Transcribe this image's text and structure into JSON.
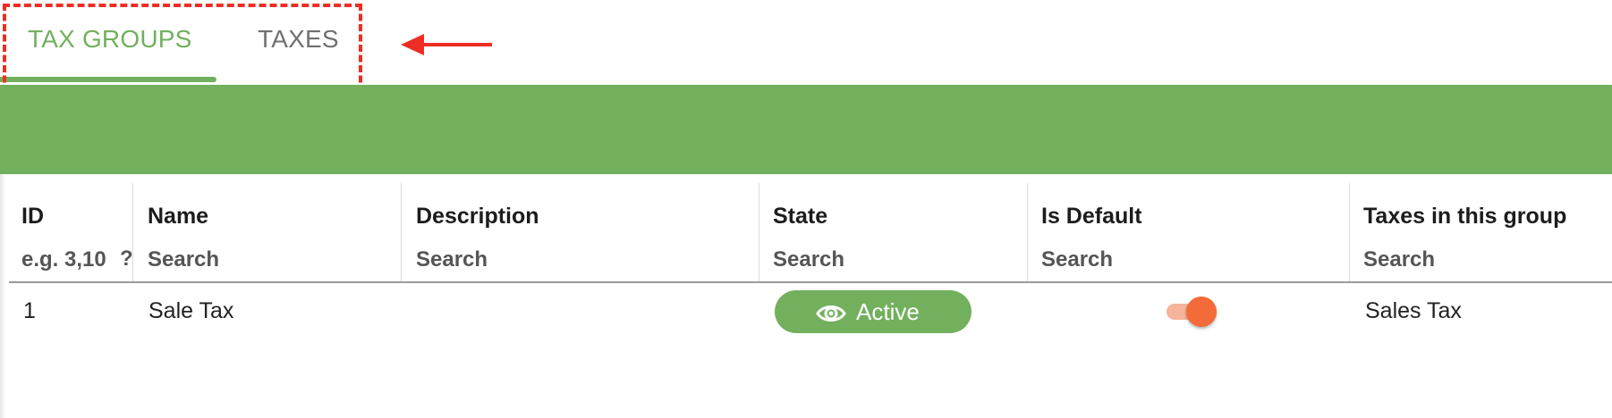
{
  "tabs": [
    {
      "label": "TAX GROUPS",
      "active": true
    },
    {
      "label": "TAXES",
      "active": false
    }
  ],
  "colors": {
    "accent_green": "#72b05d",
    "annotation_red": "#ee2e24",
    "toggle_orange": "#f26b38"
  },
  "table": {
    "columns": [
      {
        "title": "ID",
        "filter_placeholder": "e.g. 3,10",
        "filter_help": "?"
      },
      {
        "title": "Name",
        "filter_placeholder": "Search"
      },
      {
        "title": "Description",
        "filter_placeholder": "Search"
      },
      {
        "title": "State",
        "filter_placeholder": "Search"
      },
      {
        "title": "Is Default",
        "filter_placeholder": "Search"
      },
      {
        "title": "Taxes in this group",
        "filter_placeholder": "Search"
      }
    ],
    "rows": [
      {
        "id": "1",
        "name": "Sale Tax",
        "description": "",
        "state": "Active",
        "state_icon": "eye-icon",
        "is_default": true,
        "taxes": "Sales Tax"
      }
    ]
  }
}
